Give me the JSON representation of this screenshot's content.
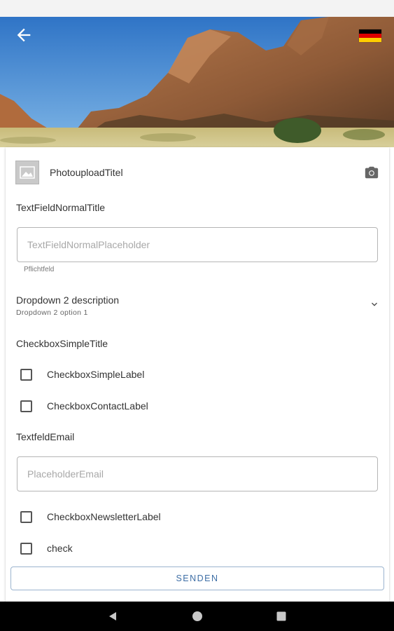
{
  "header": {
    "back_icon": "arrow-back-icon",
    "flag_icon": "flag-germany-icon",
    "flag_colors": [
      "#000000",
      "#dd0000",
      "#ffce00"
    ]
  },
  "form": {
    "photo_upload": {
      "title": "PhotouploadTitel",
      "icon": "camera-icon"
    },
    "text_field_normal": {
      "title": "TextFieldNormalTitle",
      "placeholder": "TextFieldNormalPlaceholder",
      "value": "",
      "helper": "Pflichtfeld"
    },
    "dropdown": {
      "label": "Dropdown 2 description",
      "selected": "Dropdown 2 option 1",
      "icon": "chevron-down-icon"
    },
    "checkbox_simple": {
      "title": "CheckboxSimpleTitle",
      "items": [
        {
          "label": "CheckboxSimpleLabel",
          "checked": false
        },
        {
          "label": "CheckboxContactLabel",
          "checked": false
        }
      ]
    },
    "email_field": {
      "title": "TextfeldEmail",
      "placeholder": "PlaceholderEmail",
      "value": ""
    },
    "checkbox_extra": {
      "items": [
        {
          "label": "CheckboxNewsletterLabel",
          "checked": false
        },
        {
          "label": "check",
          "checked": false
        }
      ]
    },
    "submit_label": "SENDEN"
  },
  "nav": {
    "back_icon": "nav-back-triangle-icon",
    "home_icon": "nav-home-circle-icon",
    "recents_icon": "nav-recents-square-icon"
  },
  "colors": {
    "accent": "#3d6ea5",
    "border": "#b5b5b5",
    "nav_bar": "#000000"
  }
}
